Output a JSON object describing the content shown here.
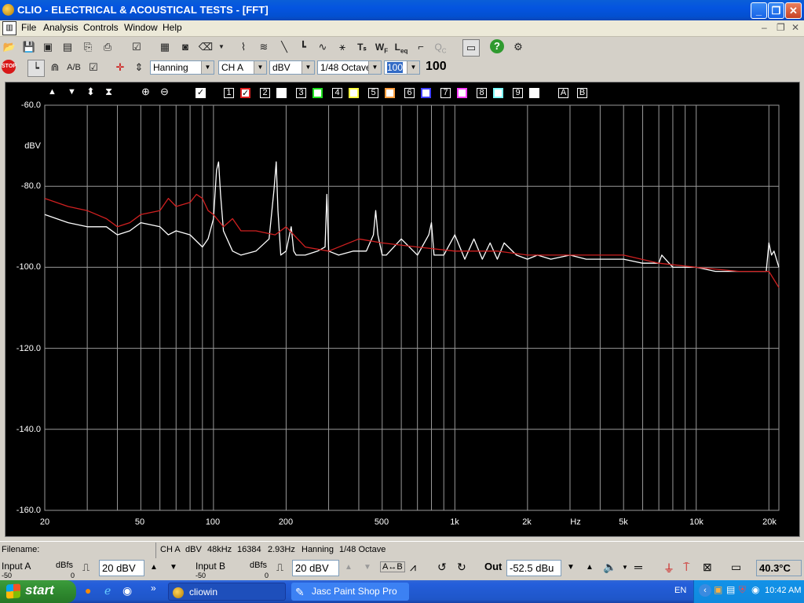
{
  "window": {
    "title": "CLIO - ELECTRICAL & ACOUSTICAL TESTS - [FFT]"
  },
  "menu": {
    "items": [
      "File",
      "Analysis",
      "Controls",
      "Window",
      "Help"
    ]
  },
  "toolbar2": {
    "window": "Hanning",
    "channel": "CH A",
    "units": "dBV",
    "smoothing": "1/48 Octave",
    "averages": "100",
    "averages_display": "100"
  },
  "graph_toolbar": {
    "overlay_numbers": [
      "1",
      "2",
      "3",
      "4",
      "5",
      "6",
      "7",
      "8",
      "9"
    ],
    "overlay_colors": [
      "#e02020",
      "#ffffff",
      "#20e020",
      "#ffff40",
      "#ffa040",
      "#4040ff",
      "#ff40ff",
      "#80ffff",
      "#ffffff"
    ],
    "letters": [
      "A",
      "B"
    ]
  },
  "chart_data": {
    "type": "line",
    "xlabel": "Hz",
    "ylabel": "dBV",
    "x_scale": "log",
    "xlim": [
      20,
      22000
    ],
    "ylim": [
      -160,
      -60
    ],
    "y_ticks": [
      "-60.0",
      "-80.0",
      "-100.0",
      "-120.0",
      "-140.0",
      "-160.0"
    ],
    "x_ticks": [
      "20",
      "50",
      "100",
      "200",
      "500",
      "1k",
      "2k",
      "Hz",
      "5k",
      "10k",
      "20k"
    ],
    "series": [
      {
        "color": "#ffffff",
        "x": [
          20,
          25,
          30,
          36,
          40,
          45,
          50,
          60,
          65,
          70,
          80,
          90,
          95,
          100,
          103,
          105,
          107,
          110,
          120,
          130,
          150,
          170,
          178,
          182,
          185,
          190,
          200,
          210,
          215,
          220,
          240,
          270,
          290,
          295,
          300,
          330,
          380,
          430,
          460,
          470,
          480,
          500,
          520,
          600,
          700,
          780,
          800,
          820,
          900,
          1000,
          1100,
          1200,
          1300,
          1400,
          1500,
          1600,
          1800,
          2000,
          2200,
          2500,
          3000,
          3500,
          4000,
          5000,
          6000,
          7000,
          7200,
          8000,
          10000,
          12000,
          15000,
          18000,
          19500,
          20000,
          20500,
          21000,
          22000
        ],
        "y": [
          -87,
          -89,
          -90,
          -90,
          -92,
          -91,
          -89,
          -90,
          -92,
          -91,
          -92,
          -95,
          -93,
          -88,
          -76,
          -74,
          -82,
          -91,
          -96,
          -97,
          -96,
          -93,
          -81,
          -74,
          -86,
          -97,
          -96,
          -90,
          -96,
          -97,
          -97,
          -96,
          -95,
          -82,
          -96,
          -97,
          -96,
          -96,
          -92,
          -86,
          -92,
          -97,
          -97,
          -93,
          -97,
          -92,
          -89,
          -97,
          -97,
          -92,
          -98,
          -93,
          -98,
          -94,
          -98,
          -94,
          -97,
          -98,
          -97,
          -98,
          -97,
          -98,
          -98,
          -98,
          -99,
          -99,
          -97,
          -100,
          -100,
          -101,
          -101,
          -101,
          -101,
          -94,
          -97,
          -96,
          -100
        ]
      },
      {
        "color": "#d02020",
        "x": [
          20,
          25,
          30,
          36,
          40,
          45,
          50,
          60,
          65,
          70,
          80,
          85,
          90,
          95,
          100,
          110,
          120,
          130,
          150,
          180,
          200,
          240,
          300,
          400,
          500,
          700,
          1000,
          1500,
          2000,
          3000,
          5000,
          7000,
          10000,
          15000,
          20000,
          22000
        ],
        "y": [
          -83,
          -85,
          -86,
          -88,
          -90,
          -89,
          -87,
          -86,
          -83,
          -85,
          -84,
          -82,
          -83,
          -86,
          -87,
          -90,
          -88,
          -91,
          -91,
          -92,
          -90,
          -95,
          -96,
          -93,
          -94,
          -95,
          -96,
          -96,
          -97,
          -97,
          -97,
          -99,
          -100,
          -101,
          -101,
          -105
        ]
      }
    ]
  },
  "status": {
    "filename_label": "Filename:",
    "filename_value": "",
    "info": [
      "CH A",
      "dBV",
      "48kHz",
      "16384",
      "2.93Hz",
      "Hanning",
      "1/48 Octave"
    ]
  },
  "inputs": {
    "a_label": "Input A",
    "a_units": "dBfs",
    "a_range": "20 dBV",
    "a_min": "-50",
    "a_zero": "0",
    "b_label": "Input B",
    "b_units": "dBfs",
    "b_range": "20 dBV",
    "b_min": "-50",
    "b_zero": "0",
    "out_label": "Out",
    "out_value": "-52.5 dBu",
    "temperature": "40.3°C"
  },
  "taskbar": {
    "start": "start",
    "tasks": [
      "cliowin",
      "Jasc Paint Shop Pro"
    ],
    "lang": "EN",
    "time": "10:42 AM"
  }
}
